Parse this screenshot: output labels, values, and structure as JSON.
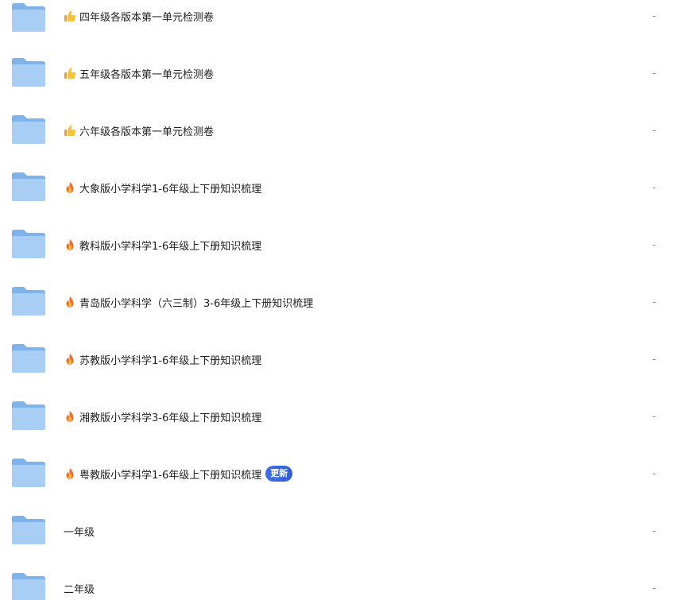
{
  "files": [
    {
      "name": "四年级各版本第一单元检测卷",
      "emoji": "thumbs-up",
      "badge": "",
      "size": "-"
    },
    {
      "name": "五年级各版本第一单元检测卷",
      "emoji": "thumbs-up",
      "badge": "",
      "size": "-"
    },
    {
      "name": "六年级各版本第一单元检测卷",
      "emoji": "thumbs-up",
      "badge": "",
      "size": "-"
    },
    {
      "name": "大象版小学科学1-6年级上下册知识梳理",
      "emoji": "fire",
      "badge": "",
      "size": "-"
    },
    {
      "name": "教科版小学科学1-6年级上下册知识梳理",
      "emoji": "fire",
      "badge": "",
      "size": "-"
    },
    {
      "name": "青岛版小学科学（六三制）3-6年级上下册知识梳理",
      "emoji": "fire",
      "badge": "",
      "size": "-"
    },
    {
      "name": "苏教版小学科学1-6年级上下册知识梳理",
      "emoji": "fire",
      "badge": "",
      "size": "-"
    },
    {
      "name": "湘教版小学科学3-6年级上下册知识梳理",
      "emoji": "fire",
      "badge": "",
      "size": "-"
    },
    {
      "name": "粤教版小学科学1-6年级上下册知识梳理",
      "emoji": "fire",
      "badge": "更新",
      "size": "-"
    },
    {
      "name": "一年级",
      "emoji": "",
      "badge": "",
      "size": "-"
    },
    {
      "name": "二年级",
      "emoji": "",
      "badge": "",
      "size": "-"
    }
  ],
  "colors": {
    "folder_back": "#7fb3ea",
    "folder_front": "#a9cef5",
    "badge": "#3c6be4",
    "text": "#222222",
    "muted": "#888888"
  }
}
